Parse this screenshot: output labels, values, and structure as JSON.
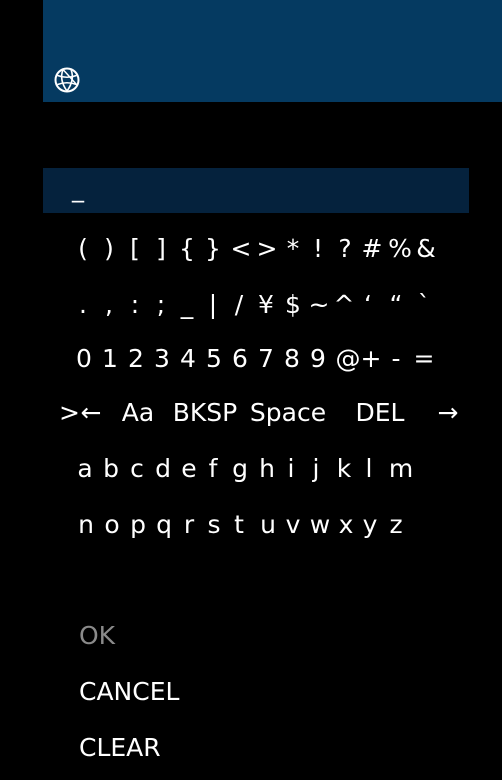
{
  "header": {
    "icon": "globe-icon",
    "color": "#053a61"
  },
  "input": {
    "value": "_",
    "color": "#05223d"
  },
  "selector_glyph": ">",
  "keyboard": {
    "rows": [
      [
        "(",
        ")",
        "[",
        "]",
        "{",
        "}",
        "<",
        ">",
        "*",
        "!",
        "?",
        "#",
        "%",
        "&"
      ],
      [
        ".",
        ",",
        ":",
        ";",
        "_",
        "|",
        "/",
        "¥",
        "$",
        "~",
        "^",
        "‘",
        "“",
        "`"
      ],
      [
        "0",
        "1",
        "2",
        "3",
        "4",
        "5",
        "6",
        "7",
        "8",
        "9",
        "@",
        "+",
        "-",
        "="
      ],
      [
        "←",
        "Aa",
        "BKSP",
        "Space",
        "DEL",
        "→"
      ],
      [
        "a",
        "b",
        "c",
        "d",
        "e",
        "f",
        "g",
        "h",
        "i",
        "j",
        "k",
        "l",
        "m"
      ],
      [
        "n",
        "o",
        "p",
        "q",
        "r",
        "s",
        "t",
        "u",
        "v",
        "w",
        "x",
        "y",
        "z"
      ]
    ]
  },
  "actions": {
    "ok": "OK",
    "cancel": "CANCEL",
    "clear": "CLEAR"
  }
}
